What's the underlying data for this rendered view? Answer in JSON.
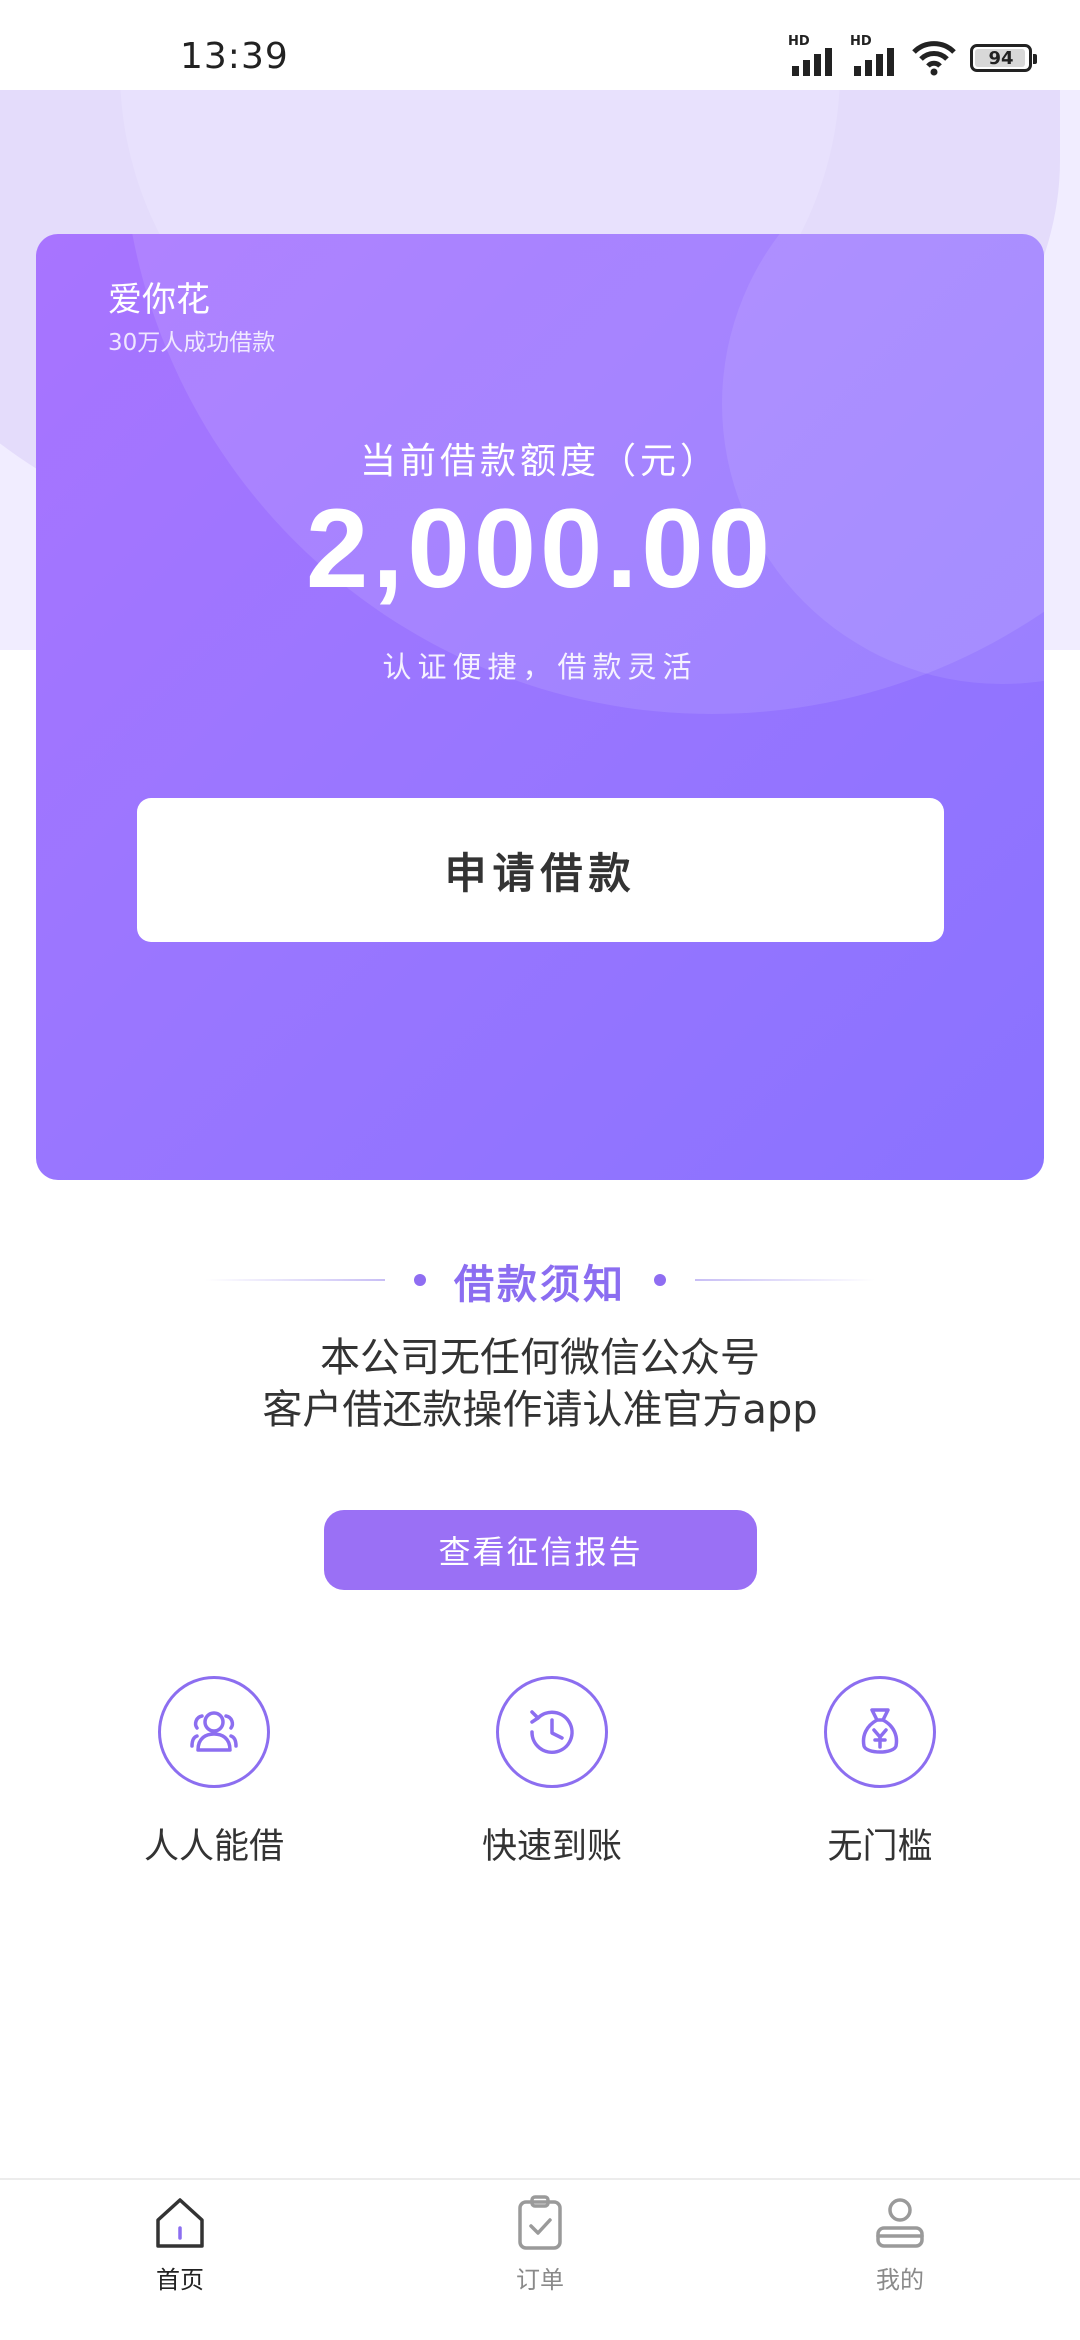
{
  "status_bar": {
    "time": "13:39",
    "battery": "94",
    "sim1_label": "HD",
    "sim2_label": "HD"
  },
  "card": {
    "brand_name": "爱你花",
    "brand_sub": "30万人成功借款",
    "limit_label": "当前借款额度（元）",
    "limit_amount": "2,000.00",
    "tagline": "认证便捷，借款灵活",
    "apply_button": "申请借款",
    "gradient_start": "#a874ff",
    "gradient_end": "#8a72ff"
  },
  "notice": {
    "title": "借款须知",
    "line1": "本公司无任何微信公众号",
    "line2": "客户借还款操作请认准官方app"
  },
  "report_button": "查看征信报告",
  "features": [
    {
      "label": "人人能借",
      "icon": "users-icon"
    },
    {
      "label": "快速到账",
      "icon": "clock-icon"
    },
    {
      "label": "无门槛",
      "icon": "money-bag-icon"
    }
  ],
  "bottom_nav": [
    {
      "label": "首页",
      "icon": "home-icon",
      "active": true
    },
    {
      "label": "订单",
      "icon": "clipboard-check-icon",
      "active": false
    },
    {
      "label": "我的",
      "icon": "user-icon",
      "active": false
    }
  ],
  "colors": {
    "accent": "#8c6ef0",
    "report_button": "#9a70f5"
  }
}
